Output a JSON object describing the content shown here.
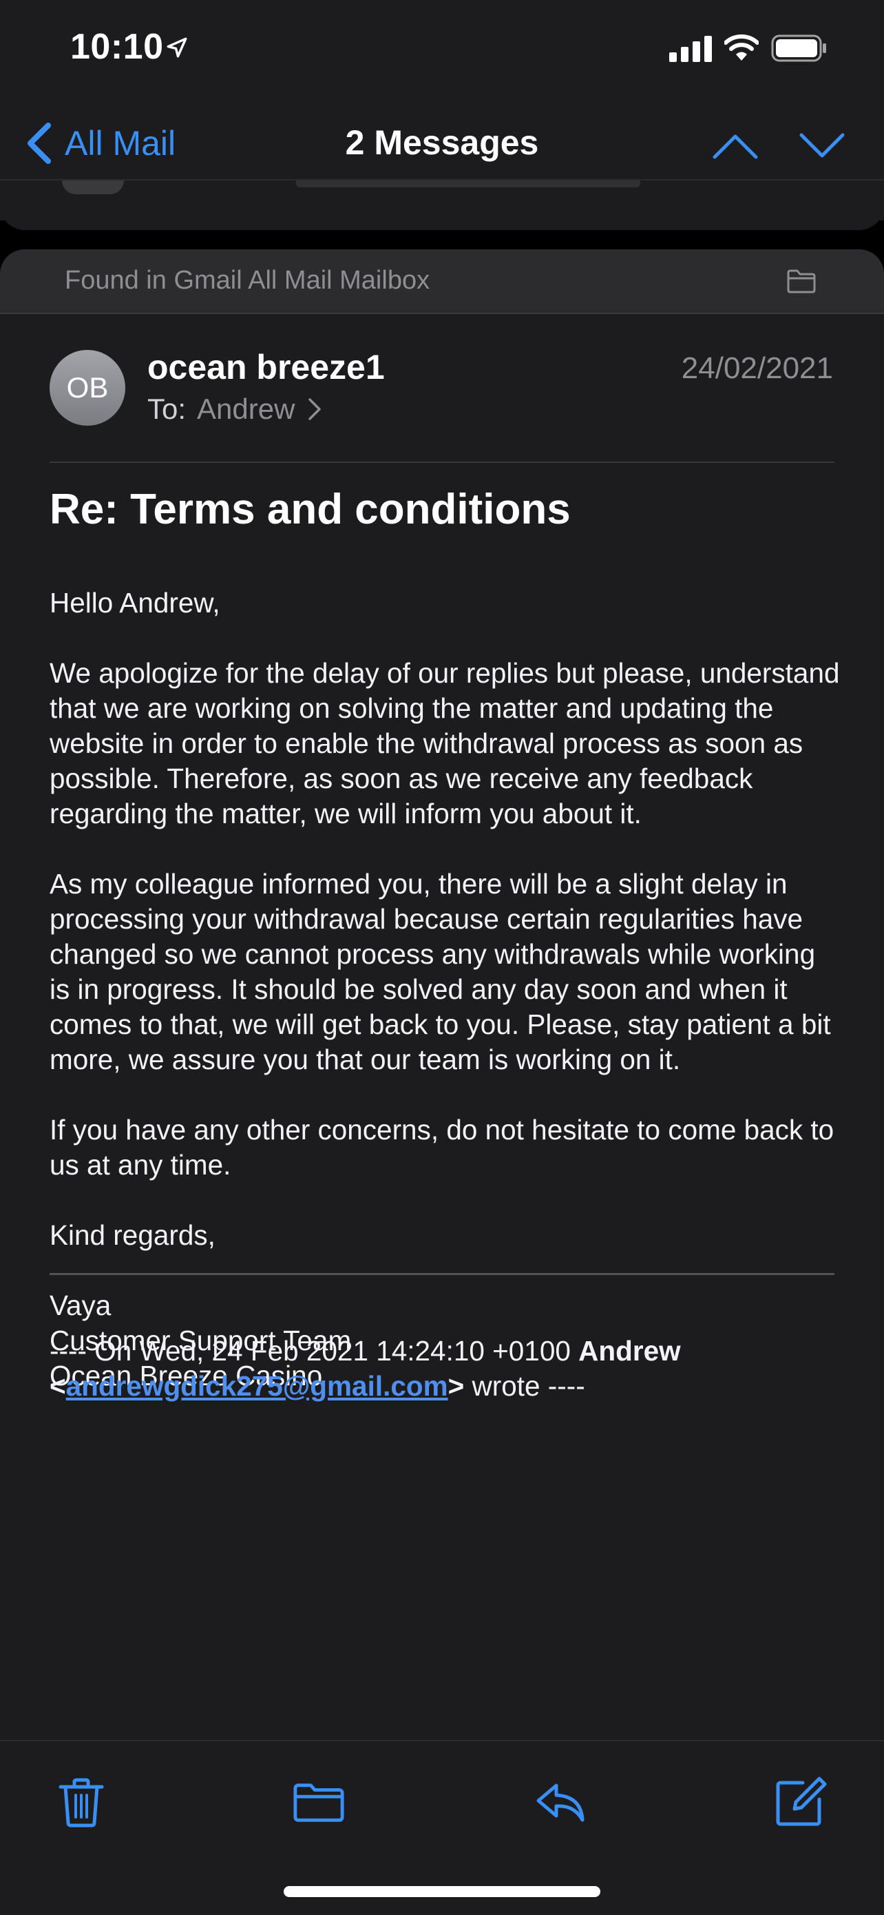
{
  "status_bar": {
    "time": "10:10",
    "icons": [
      "location-arrow-icon",
      "cellular-signal-icon",
      "wifi-icon",
      "battery-icon"
    ]
  },
  "nav": {
    "back_label": "All Mail",
    "title": "2 Messages",
    "icons": [
      "chevron-left-icon",
      "chevron-up-icon",
      "chevron-down-icon"
    ]
  },
  "banner": {
    "text": "Found in Gmail All Mail Mailbox",
    "icon": "folder-icon"
  },
  "message": {
    "avatar_initials": "OB",
    "sender": "ocean breeze1",
    "to_prefix": "To:",
    "to_name": "Andrew",
    "date": "24/02/2021",
    "subject": "Re: Terms and conditions",
    "body": [
      "Hello Andrew,",
      "We apologize for the delay of our replies but please, understand that we are working on solving the matter and updating the website in order to enable the withdrawal process as soon as possible. Therefore, as soon as we receive any feedback regarding the matter, we will inform you about it.",
      "As my colleague informed you, there will be a slight delay in processing your withdrawal because certain regularities have changed so we cannot process any withdrawals while working is in progress. It should be solved any day soon and when it comes to that, we will get back to you. Please, stay patient a bit more, we assure you that our team is working on it.",
      "If you have any other concerns, do not hesitate to come back to us at any time.",
      "Kind regards,"
    ],
    "signature": [
      "Vaya",
      "Customer Support Team",
      "Ocean Breeze Casino"
    ],
    "quote": {
      "prefix": "---- On Wed, 24 Feb 2021 14:24:10 +0100 ",
      "author": "Andrew",
      "open": "<",
      "email": "andrewgdick275@gmail.com",
      "close": ">",
      "suffix": " wrote ----"
    }
  },
  "toolbar": [
    "trash-icon",
    "folder-icon",
    "reply-icon",
    "compose-icon"
  ],
  "colors": {
    "accent": "#3a8ff5",
    "background": "#1c1c1e",
    "secondary_text": "#8e8e93"
  }
}
